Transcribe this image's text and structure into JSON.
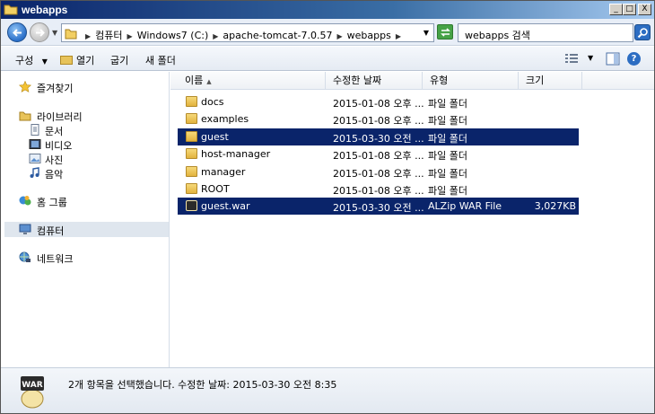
{
  "window": {
    "title": "webapps",
    "min_label": "_",
    "max_label": "□",
    "close_label": "X"
  },
  "address": {
    "crumbs": [
      "컴퓨터",
      "Windows7 (C:)",
      "apache-tomcat-7.0.57",
      "webapps"
    ],
    "search_placeholder": "webapps 검색"
  },
  "toolbar": {
    "organize_label": "구성",
    "open_label": "열기",
    "burn_label": "굽기",
    "new_folder_label": "새 폴더"
  },
  "sidebar": {
    "favorites": "즐겨찾기",
    "libraries": "라이브러리",
    "library_items": [
      "문서",
      "비디오",
      "사진",
      "음악"
    ],
    "homegroup": "홈 그룹",
    "computer": "컴퓨터",
    "network": "네트워크"
  },
  "columns": {
    "name": "이름",
    "date": "수정한 날짜",
    "type": "유형",
    "size": "크기"
  },
  "files": [
    {
      "name": "docs",
      "date": "2015-01-08 오후 ...",
      "type": "파일 폴더",
      "size": "",
      "icon": "folder-icon",
      "selected": false
    },
    {
      "name": "examples",
      "date": "2015-01-08 오후 ...",
      "type": "파일 폴더",
      "size": "",
      "icon": "folder-icon",
      "selected": false
    },
    {
      "name": "guest",
      "date": "2015-03-30 오전 ...",
      "type": "파일 폴더",
      "size": "",
      "icon": "folder-icon",
      "selected": true
    },
    {
      "name": "host-manager",
      "date": "2015-01-08 오후 ...",
      "type": "파일 폴더",
      "size": "",
      "icon": "folder-icon",
      "selected": false
    },
    {
      "name": "manager",
      "date": "2015-01-08 오후 ...",
      "type": "파일 폴더",
      "size": "",
      "icon": "folder-icon",
      "selected": false
    },
    {
      "name": "ROOT",
      "date": "2015-01-08 오후 ...",
      "type": "파일 폴더",
      "size": "",
      "icon": "folder-icon",
      "selected": false
    },
    {
      "name": "guest.war",
      "date": "2015-03-30 오전 ...",
      "type": "ALZip WAR File",
      "size": "3,027KB",
      "icon": "war-file-icon",
      "selected": true
    }
  ],
  "status": {
    "icon_label": "WAR",
    "text": "2개 항목을 선택했습니다.  수정한 날짜: 2015-03-30 오전 8:35"
  },
  "colors": {
    "selection": "#0a246a",
    "title_bar": "#0a246a"
  }
}
